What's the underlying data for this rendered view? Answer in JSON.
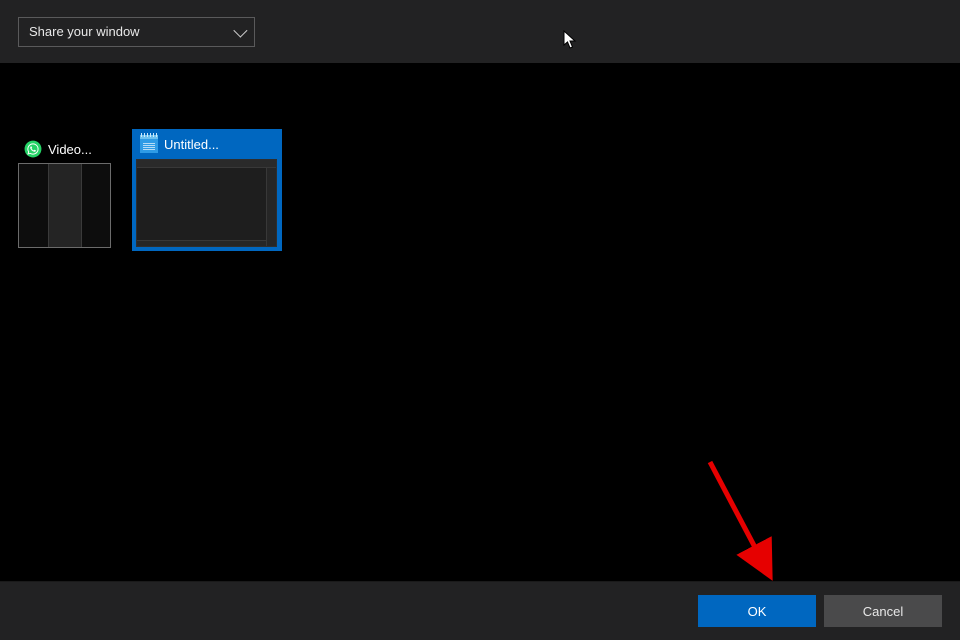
{
  "header": {
    "dropdown_label": "Share your window"
  },
  "windows": [
    {
      "label": "Video...",
      "icon": "whatsapp-icon",
      "selected": false
    },
    {
      "label": "Untitled...",
      "icon": "notepad-icon",
      "selected": true
    }
  ],
  "footer": {
    "ok_label": "OK",
    "cancel_label": "Cancel"
  },
  "annotation": {
    "arrow_target": "ok-button",
    "arrow_color": "#e60000"
  }
}
